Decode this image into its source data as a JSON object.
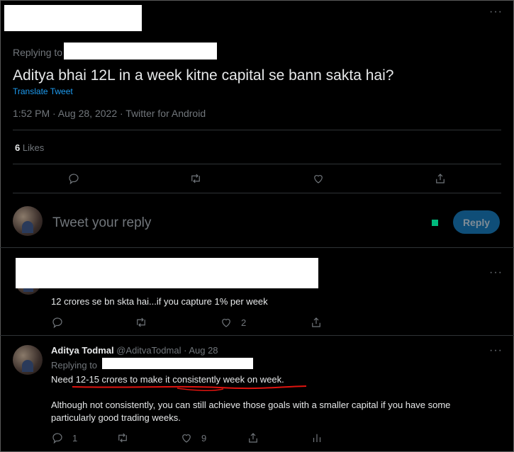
{
  "main_tweet": {
    "replying_to_label": "Replying to",
    "text": "Aditya bhai 12L in a week kitne capital se bann sakta hai?",
    "translate_label": "Translate Tweet",
    "meta": "1:52 PM · Aug 28, 2022 · Twitter for Android",
    "likes_count": "6",
    "likes_label": "Likes"
  },
  "composer": {
    "placeholder": "Tweet your reply",
    "reply_button": "Reply"
  },
  "reply1": {
    "text": "12 crores se bn skta hai...if you capture 1% per week",
    "like_count": "2"
  },
  "reply2": {
    "author_name": "Aditya Todmal",
    "author_handle": "@AditvaTodmal",
    "date": "· Aug 28",
    "replying_to_label": "Replying to",
    "text_highlight": "Need 12-15 crores to make it consistently week on week.",
    "text_body": "Although not consistently, you can still achieve those goals with a smaller capital if you have some particularly good trading weeks.",
    "reply_count": "1",
    "like_count": "9"
  },
  "colors": {
    "accent": "#1d9bf0",
    "background": "#000000",
    "divider": "#2f3336",
    "muted": "#71767b",
    "annotation": "#e0140f"
  },
  "icons": [
    "more-icon",
    "reply-icon",
    "retweet-icon",
    "like-icon",
    "share-icon",
    "analytics-icon"
  ]
}
